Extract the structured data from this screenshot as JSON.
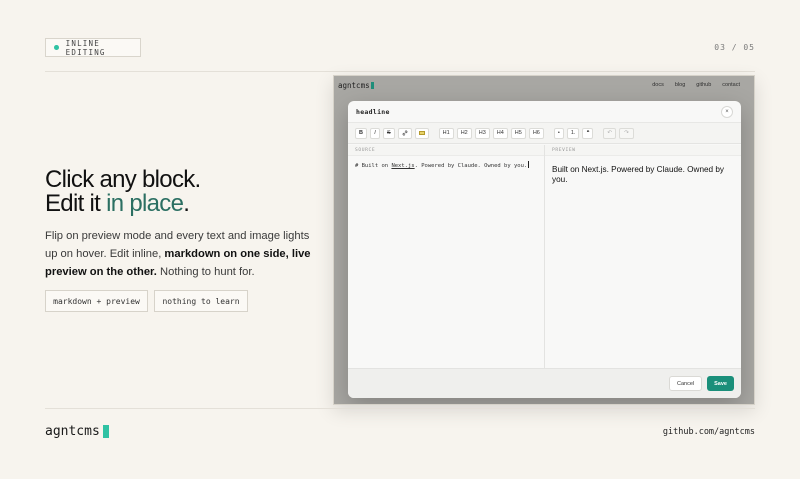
{
  "header": {
    "tag_label": "INLINE EDITING",
    "counter": "03 / 05"
  },
  "hero": {
    "line1": "Click any block.",
    "line2_prefix": "Edit it ",
    "line2_accent": "in place",
    "line2_suffix": ".",
    "body_part1": "Flip on preview mode and every text and image lights up on hover. Edit inline, ",
    "body_bold": "markdown on one side, live preview on the other.",
    "body_part2": " Nothing to hunt for.",
    "chips": [
      "markdown + preview",
      "nothing to learn"
    ]
  },
  "screenshot": {
    "site": {
      "brand": "agntcms",
      "nav": [
        "docs",
        "blog",
        "github",
        "contact"
      ]
    },
    "modal": {
      "title": "headline",
      "close_glyph": "×",
      "toolbar": {
        "group1": [
          "B",
          "I",
          "S",
          "🔗"
        ],
        "group2": [
          "H1",
          "H2",
          "H3",
          "H4",
          "H5",
          "H6"
        ],
        "group3": [
          "•",
          "1.",
          "❝"
        ],
        "group4": [
          "↶",
          "↷"
        ]
      },
      "source_label": "SOURCE",
      "preview_label": "PREVIEW",
      "source_prefix": "# Built on ",
      "source_link": "Next.js",
      "source_suffix": ". Powered by Claude. Owned by you.",
      "preview_text": "Built on Next.js. Powered by Claude. Owned by you.",
      "cancel_label": "Cancel",
      "save_label": "Save"
    }
  },
  "footer": {
    "brand": "agntcms",
    "link": "github.com/agntcms"
  },
  "colors": {
    "background": "#f7f4ee",
    "accent": "#2fc2a3",
    "accent_text": "#2b6f62",
    "save_button": "#1a8f7a"
  },
  "icons": [
    "dot-icon",
    "close-icon",
    "image-icon",
    "link-icon",
    "bullet-list-icon",
    "numbered-list-icon",
    "quote-icon",
    "undo-icon",
    "redo-icon"
  ]
}
